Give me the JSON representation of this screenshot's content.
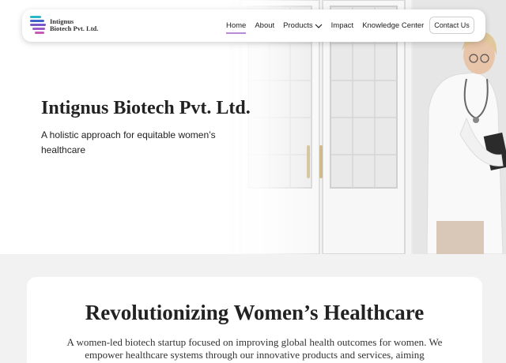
{
  "brand": {
    "logo_line1": "Intignus",
    "logo_line2": "Biotech Pvt. Ltd.",
    "colors": {
      "teal": "#2bb7c9",
      "blue": "#3d63c9",
      "purple": "#7b56c8",
      "pink": "#c85ab4",
      "active_underline": "#b98bd6"
    }
  },
  "nav": {
    "items": [
      {
        "label": "Home",
        "active": true
      },
      {
        "label": "About"
      },
      {
        "label": "Products",
        "has_dropdown": true
      },
      {
        "label": "Impact"
      },
      {
        "label": "Knowledge Center"
      }
    ],
    "contact_label": "Contact Us"
  },
  "hero": {
    "title": "Intignus Biotech Pvt. Ltd.",
    "tagline": "A holistic approach for equitable women’s healthcare",
    "image": "doctor-with-clipboard"
  },
  "about": {
    "title": "Revolutionizing Women’s Healthcare",
    "body": "A women-led biotech startup focused on improving global health outcomes for women. We empower healthcare systems through our innovative products and services, aiming"
  }
}
